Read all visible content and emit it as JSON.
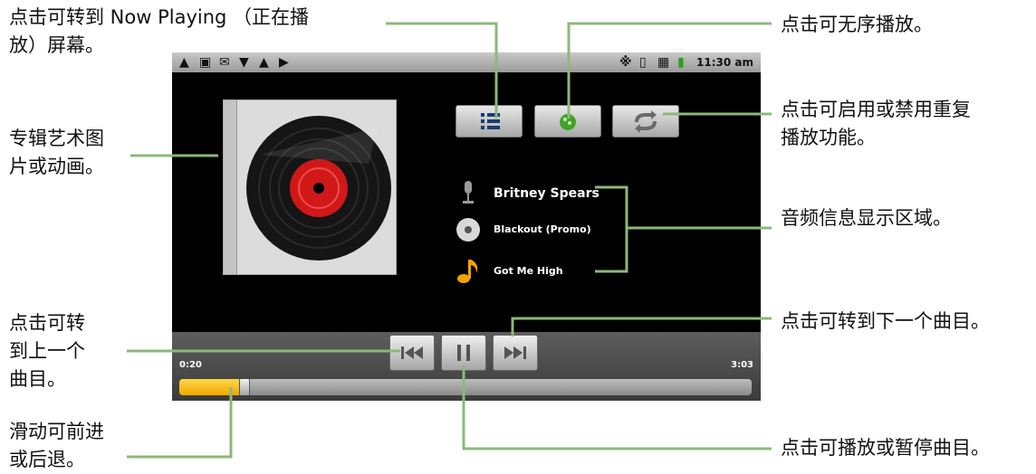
{
  "status_bar": {
    "time": "11:30 am",
    "left_icons": [
      "warning-icon",
      "chat-icon",
      "mail-icon",
      "usb-icon",
      "warning-icon",
      "play-store-icon"
    ],
    "right_icons": [
      "bluetooth-icon",
      "vibrate-icon",
      "signal-icon",
      "battery-icon"
    ]
  },
  "player": {
    "artist": "Britney Spears",
    "album": "Blackout (Promo)",
    "song": "Got Me High",
    "elapsed": "0:20",
    "duration": "3:03",
    "progress_fraction": 0.11
  },
  "callouts": {
    "now_playing": [
      "点击可转到 Now Playing （正在播",
      "放）屏幕。"
    ],
    "album_art": [
      "专辑艺术图",
      "片或动画。"
    ],
    "prev_track": [
      "点击可转",
      "到上一个",
      "曲目。"
    ],
    "seek": [
      "滑动可前进",
      "或后退。"
    ],
    "shuffle": [
      "点击可无序播放。"
    ],
    "repeat": [
      "点击可启用或禁用重复",
      "播放功能。"
    ],
    "audio_info": [
      "音频信息显示区域。"
    ],
    "next_track": [
      "点击可转到下一个曲目。"
    ],
    "play_pause": [
      "点击可播放或暂停曲目。"
    ]
  },
  "colors": {
    "callout_line": "#8db87a",
    "progress_fill": "#f5b800",
    "screen_bg": "#000000"
  }
}
